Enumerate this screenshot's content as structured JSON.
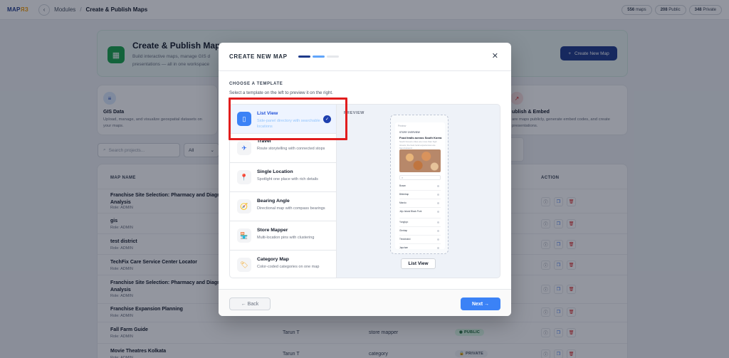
{
  "topbar": {
    "logo_main": "MAP",
    "logo_accent": "ЯЗ",
    "back_icon": "chevron-left-icon",
    "crumb_root": "Modules",
    "crumb_sep": "/",
    "crumb_current": "Create & Publish Maps",
    "stats": [
      {
        "value": "556",
        "label": "maps"
      },
      {
        "value": "208",
        "label": "Public"
      },
      {
        "value": "348",
        "label": "Private"
      }
    ]
  },
  "hero": {
    "icon": "map-icon",
    "title": "Create & Publish Maps",
    "desc_line1": "Build interactive maps, manage GIS d",
    "desc_line2": "presentations — all in one workspace",
    "new_button": "Create New Map",
    "new_button_icon": "+"
  },
  "cards": [
    {
      "title": "GIS Data",
      "desc": "Upload, manage, and visualize geospatial datasets on your maps.",
      "icon": "database-icon"
    },
    {
      "title": "ublish & Embed",
      "desc": "are maps publicly, generate embed codes, and create presentations.",
      "icon": "share-icon"
    }
  ],
  "filters": {
    "search_placeholder": "Search projects...",
    "status_value": "All"
  },
  "table": {
    "headers": {
      "name": "MAP NAME",
      "action": "ACTION"
    },
    "rows": [
      {
        "name": "Franchise Site Selection: Pharmacy and Diagn",
        "name2": "Analysis",
        "role": "Role: ADMIN"
      },
      {
        "name": "gis",
        "name2": "",
        "role": "Role: ADMIN"
      },
      {
        "name": "test district",
        "name2": "",
        "role": "Role: ADMIN"
      },
      {
        "name": "TechFix Care Service Center Locator",
        "name2": "",
        "role": "Role: ADMIN"
      },
      {
        "name": "Franchise Site Selection: Pharmacy and Diagn",
        "name2": "Analysis",
        "role": "Role: ADMIN"
      },
      {
        "name": "Franchise Expansion Planning",
        "name2": "",
        "role": "Role: ADMIN"
      },
      {
        "name": "Fall Farm Guide",
        "name2": "",
        "role": "Role: ADMIN",
        "owner": "Tarun T",
        "template": "store mapper",
        "status": "PUBLIC"
      },
      {
        "name": "Movie Theatres Kolkata",
        "name2": "",
        "role": "Role: ADMIN",
        "owner": "Tarun T",
        "template": "category",
        "status": "PRIVATE"
      }
    ]
  },
  "modal": {
    "title": "CREATE NEW MAP",
    "section": "CHOOSE A TEMPLATE",
    "hint": "Select a template on the left to preview it on the right.",
    "preview_label": "PREVIEW",
    "templates": [
      {
        "name": "List View",
        "desc": "Side-panel directory with searchable locations",
        "icon": "list-icon",
        "glyph": "▯"
      },
      {
        "name": "Travel",
        "desc": "Route storytelling with connected stops",
        "icon": "plane-icon",
        "glyph": "✈"
      },
      {
        "name": "Single Location",
        "desc": "Spotlight one place with rich details",
        "icon": "pin-icon",
        "glyph": "📍"
      },
      {
        "name": "Bearing Angle",
        "desc": "Directional map with compass bearings",
        "icon": "compass-icon",
        "glyph": "🧭"
      },
      {
        "name": "Store Mapper",
        "desc": "Multi-location pins with clustering",
        "icon": "store-icon",
        "glyph": "🏪"
      },
      {
        "name": "Category Map",
        "desc": "Color-coded categories on one map",
        "icon": "tag-icon",
        "glyph": "🏷"
      }
    ],
    "phone": {
      "tag": "Preview",
      "story": "STORY OVERVIEW",
      "heading": "Food trails across South Korea",
      "desc": "South Korea's cities are more than high streets; the best local experiences are found around ...",
      "search_icon": "search-icon",
      "items": [
        "Busan",
        "Bibimbap",
        "Mandu",
        "Jeju Island Black Pork",
        "Yongbyo",
        "Gimbap",
        "Tteokbokki",
        "Japchae"
      ]
    },
    "preview_name": "List View",
    "back_label": "← Back",
    "next_label": "Next →",
    "close_icon": "close-icon",
    "close_glyph": "✕"
  }
}
